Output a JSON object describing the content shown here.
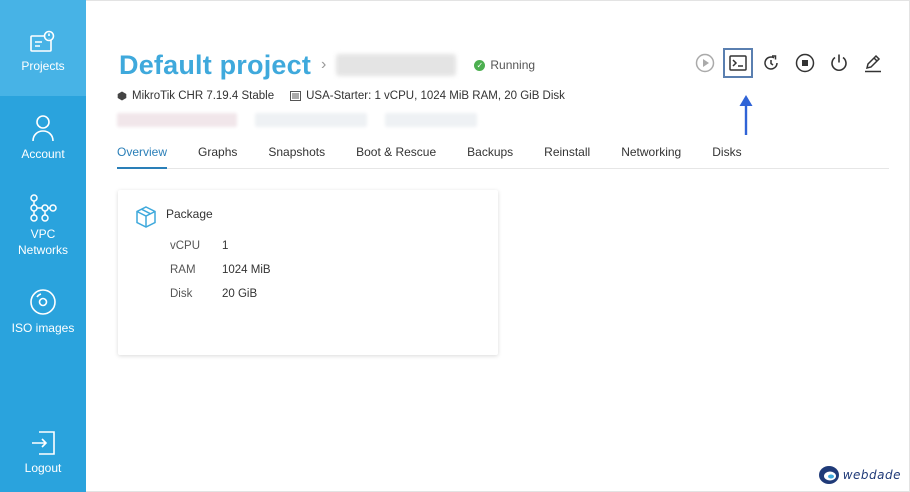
{
  "sidebar": {
    "items": [
      {
        "label": "Projects",
        "icon": "projects-icon"
      },
      {
        "label": "Account",
        "icon": "user-icon"
      },
      {
        "label": "VPC\nNetworks",
        "label_line1": "VPC",
        "label_line2": "Networks",
        "icon": "network-icon"
      },
      {
        "label": "ISO images",
        "icon": "disc-icon"
      },
      {
        "label": "Logout",
        "icon": "logout-icon"
      }
    ]
  },
  "header": {
    "title": "Default project",
    "breadcrumb_separator": "›",
    "status": "Running"
  },
  "info": {
    "os": "MikroTik CHR 7.19.4 Stable",
    "plan": "USA-Starter: 1 vCPU, 1024 MiB RAM, 20 GiB Disk"
  },
  "toolbar": {
    "buttons": [
      "play-icon",
      "console-icon",
      "reinstall-icon",
      "stop-icon",
      "power-icon",
      "edit-icon"
    ]
  },
  "tabs": [
    "Overview",
    "Graphs",
    "Snapshots",
    "Boot & Rescue",
    "Backups",
    "Reinstall",
    "Networking",
    "Disks"
  ],
  "active_tab": "Overview",
  "package": {
    "title": "Package",
    "specs": [
      {
        "key": "vCPU",
        "value": "1"
      },
      {
        "key": "RAM",
        "value": "1024 MiB"
      },
      {
        "key": "Disk",
        "value": "20 GiB"
      }
    ]
  },
  "logo": {
    "text": "webdade"
  },
  "colors": {
    "sidebar": "#2aa3dd",
    "title": "#3fa9dc",
    "running": "#4caf50",
    "active_tab": "#2a7fb8",
    "highlight": "#5a7fb0",
    "arrow": "#2f63d6"
  }
}
